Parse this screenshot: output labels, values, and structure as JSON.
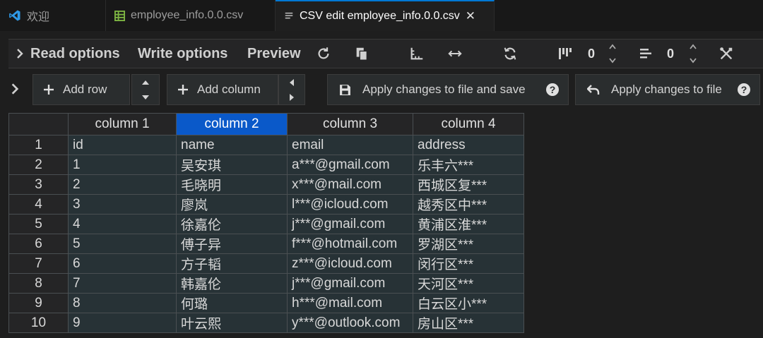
{
  "tabs": [
    {
      "label": "欢迎",
      "icon": "vscode-logo-icon"
    },
    {
      "label": "employee_info.0.0.csv",
      "icon": "table-file-icon"
    },
    {
      "label": "CSV edit employee_info.0.0.csv",
      "icon": "preview-icon",
      "active": true
    }
  ],
  "toolbar": {
    "read_options": "Read options",
    "write_options": "Write options",
    "preview": "Preview",
    "col_width_value": "0",
    "row_value": "0"
  },
  "actions": {
    "add_row": "Add row",
    "add_column": "Add column",
    "apply_save": "Apply changes to file and save",
    "apply": "Apply changes to file"
  },
  "table": {
    "headers": [
      "column 1",
      "column 2",
      "column 3",
      "column 4"
    ],
    "selected_header": 1,
    "rows": [
      [
        "1",
        "id",
        "name",
        "email",
        "address"
      ],
      [
        "2",
        "1",
        "吴安琪",
        "a***@gmail.com",
        "乐丰六***"
      ],
      [
        "3",
        "2",
        "毛晓明",
        "x***@mail.com",
        "西城区复***"
      ],
      [
        "4",
        "3",
        "廖岚",
        "l***@icloud.com",
        "越秀区中***"
      ],
      [
        "5",
        "4",
        "徐嘉伦",
        "j***@gmail.com",
        "黄浦区淮***"
      ],
      [
        "6",
        "5",
        "傅子异",
        "f***@hotmail.com",
        "罗湖区***"
      ],
      [
        "7",
        "6",
        "方子韬",
        "z***@icloud.com",
        "闵行区***"
      ],
      [
        "8",
        "7",
        "韩嘉伦",
        "j***@gmail.com",
        "天河区***"
      ],
      [
        "9",
        "8",
        "何璐",
        "h***@mail.com",
        "白云区小***"
      ],
      [
        "10",
        "9",
        "叶云熙",
        "y***@outlook.com",
        "房山区***"
      ]
    ]
  },
  "colors": {
    "accent": "#0078d4",
    "selected_header": "#0a59c9"
  }
}
